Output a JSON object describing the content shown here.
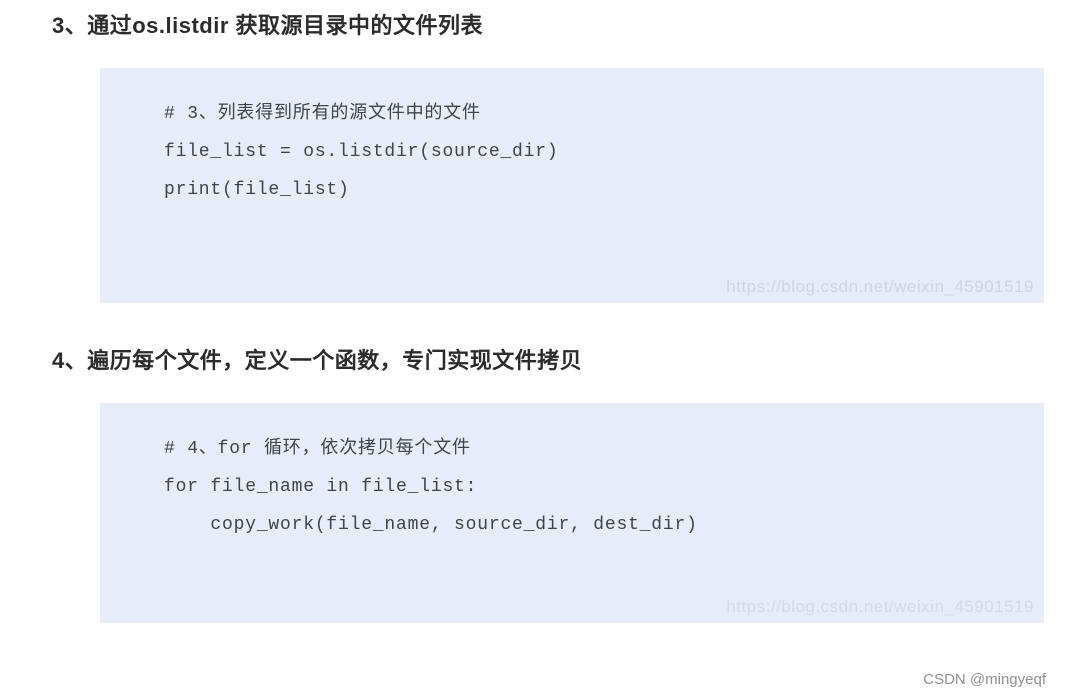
{
  "sections": [
    {
      "heading": "3、通过os.listdir 获取源目录中的文件列表",
      "code": {
        "lines": [
          "# 3、列表得到所有的源文件中的文件",
          "file_list = os.listdir(source_dir)",
          "print(file_list)"
        ]
      },
      "watermark": "https://blog.csdn.net/weixin_45901519"
    },
    {
      "heading": "4、遍历每个文件，定义一个函数，专门实现文件拷贝",
      "code": {
        "lines": [
          "# 4、for 循环，依次拷贝每个文件",
          "for file_name in file_list:",
          "    copy_work(file_name, source_dir, dest_dir)"
        ]
      },
      "watermark": "https://blog.csdn.net/weixin_45901519"
    }
  ],
  "footer_watermark": "CSDN @mingyeqf"
}
